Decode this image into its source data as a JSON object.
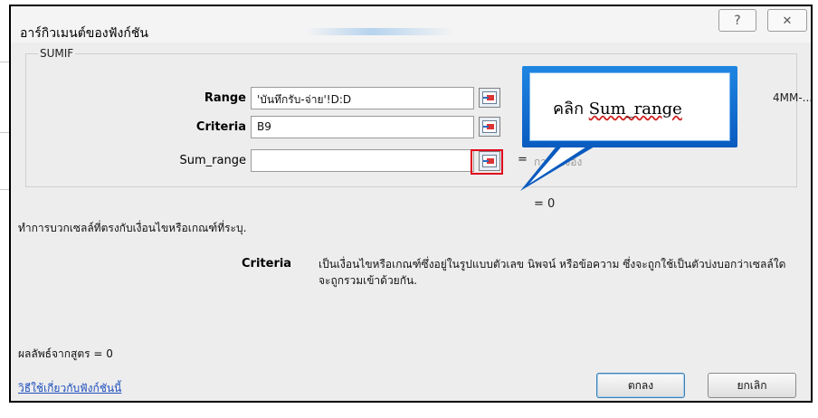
{
  "dialog": {
    "title": "อาร์กิวเมนต์ของฟังก์ชัน",
    "help_glyph": "?",
    "close_glyph": "X"
  },
  "function_group": {
    "name": "SUMIF",
    "args": [
      {
        "label": "Range",
        "value": "'บันทึกรับ-จ่าย'!D:D",
        "preview": "{\"ไฟ...ค่าใช้จ่าย\";\"...4MM-...\"}",
        "bold": true
      },
      {
        "label": "Criteria",
        "value": "B9",
        "preview": "",
        "bold": true
      },
      {
        "label": "Sum_range",
        "value": "",
        "preview": "การอ้างอิง",
        "bold": false
      }
    ]
  },
  "range_preview_tail": "4MM-...",
  "sum_range_preview": "การอ้างอิง",
  "formula_value": "=  0",
  "function_description": "ทำการบวกเซลล์ที่ตรงกับเงื่อนไขหรือเกณฑ์ที่ระบุ.",
  "argument_help": {
    "name": "Criteria",
    "text": "เป็นเงื่อนไขหรือเกณฑ์ซึ่งอยู่ในรูปแบบตัวเลข นิพจน์ หรือข้อความ ซึ่งจะถูกใช้เป็นตัวบ่งบอกว่าเซลล์ใดจะถูกรวมเข้าด้วยกัน."
  },
  "formula_result": "ผลลัพธ์จากสูตร =  0",
  "help_link": "วิธีใช้เกี่ยวกับฟังก์ชันนี้",
  "buttons": {
    "ok": "ตกลง",
    "cancel": "ยกเลิก"
  },
  "callout": {
    "prefix": "คลิก ",
    "emphasis": "Sum_range"
  },
  "colors": {
    "callout_blue": "#0a6fd6",
    "highlight_red": "#e0001a",
    "link_blue": "#1f4fbd"
  }
}
